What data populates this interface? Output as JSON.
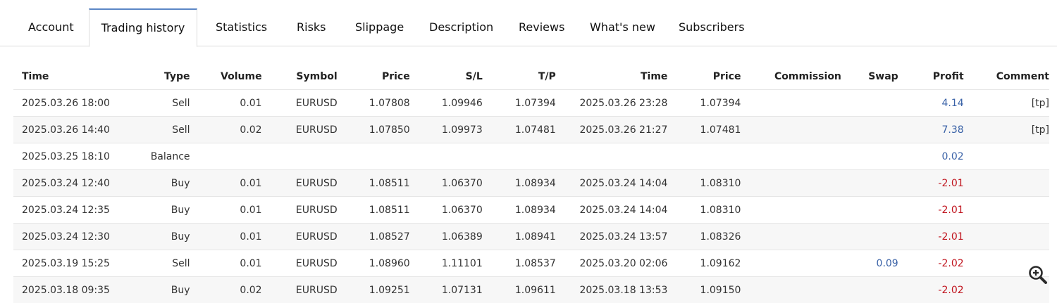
{
  "tabs": [
    {
      "label": "Account"
    },
    {
      "label": "Trading history",
      "active": true
    },
    {
      "label": "Statistics"
    },
    {
      "label": "Risks"
    },
    {
      "label": "Slippage"
    },
    {
      "label": "Description"
    },
    {
      "label": "Reviews"
    },
    {
      "label": "What's new"
    },
    {
      "label": "Subscribers"
    }
  ],
  "table": {
    "headers": [
      "Time",
      "Type",
      "Volume",
      "Symbol",
      "Price",
      "S/L",
      "T/P",
      "Time",
      "Price",
      "Commission",
      "Swap",
      "Profit",
      "Comment"
    ],
    "rows": [
      [
        "2025.03.26 18:00",
        "Sell",
        "0.01",
        "EURUSD",
        "1.07808",
        "1.09946",
        "1.07394",
        "2025.03.26 23:28",
        "1.07394",
        "",
        "",
        "4.14",
        "[tp]"
      ],
      [
        "2025.03.26 14:40",
        "Sell",
        "0.02",
        "EURUSD",
        "1.07850",
        "1.09973",
        "1.07481",
        "2025.03.26 21:27",
        "1.07481",
        "",
        "",
        "7.38",
        "[tp]"
      ],
      [
        "2025.03.25 18:10",
        "Balance",
        "",
        "",
        "",
        "",
        "",
        "",
        "",
        "",
        "",
        "0.02",
        ""
      ],
      [
        "2025.03.24 12:40",
        "Buy",
        "0.01",
        "EURUSD",
        "1.08511",
        "1.06370",
        "1.08934",
        "2025.03.24 14:04",
        "1.08310",
        "",
        "",
        "-2.01",
        ""
      ],
      [
        "2025.03.24 12:35",
        "Buy",
        "0.01",
        "EURUSD",
        "1.08511",
        "1.06370",
        "1.08934",
        "2025.03.24 14:04",
        "1.08310",
        "",
        "",
        "-2.01",
        ""
      ],
      [
        "2025.03.24 12:30",
        "Buy",
        "0.01",
        "EURUSD",
        "1.08527",
        "1.06389",
        "1.08941",
        "2025.03.24 13:57",
        "1.08326",
        "",
        "",
        "-2.01",
        ""
      ],
      [
        "2025.03.19 15:25",
        "Sell",
        "0.01",
        "EURUSD",
        "1.08960",
        "1.11101",
        "1.08537",
        "2025.03.20 02:06",
        "1.09162",
        "",
        "0.09",
        "-2.02",
        ""
      ],
      [
        "2025.03.18 09:35",
        "Buy",
        "0.02",
        "EURUSD",
        "1.09251",
        "1.07131",
        "1.09611",
        "2025.03.18 13:53",
        "1.09150",
        "",
        "",
        "-2.02",
        ""
      ]
    ]
  },
  "colors": {
    "active_tab_accent": "#5b86c6",
    "positive": "#3a62a7",
    "negative": "#c0141e"
  },
  "icons": {
    "zoom": "zoom-in-icon"
  }
}
